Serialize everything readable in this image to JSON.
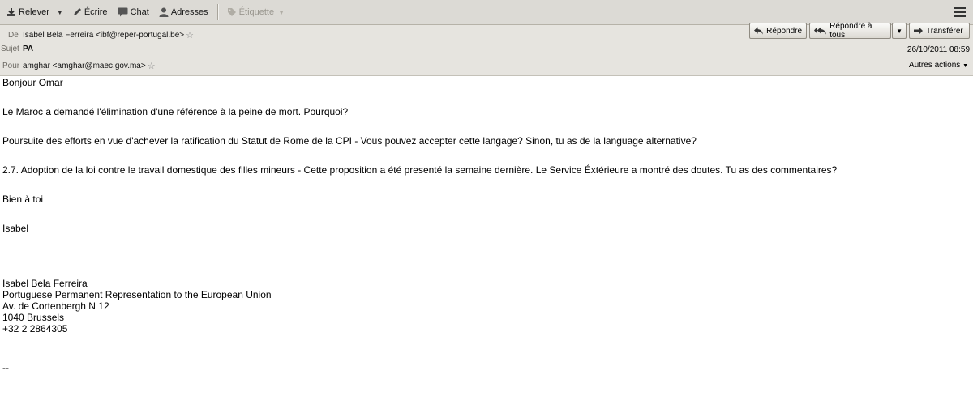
{
  "toolbar": {
    "relever": "Relever",
    "ecrire": "Écrire",
    "chat": "Chat",
    "adresses": "Adresses",
    "etiquette": "Étiquette"
  },
  "header": {
    "from_label": "De",
    "from_value": "Isabel Bela Ferreira <ibf@reper-portugal.be>",
    "subject_label": "Sujet",
    "subject_value": "PA",
    "to_label": "Pour",
    "to_value": "amghar <amghar@maec.gov.ma>",
    "date": "26/10/2011 08:59",
    "reply": "Répondre",
    "reply_all": "Répondre à tous",
    "forward": "Transférer",
    "more_actions": "Autres actions"
  },
  "body": {
    "greeting": "Bonjour Omar",
    "para1": "Le Maroc a demandé l'élimination d'une référence à la peine de mort. Pourquoi?",
    "para2": "Poursuite des efforts en vue d'achever la ratification du Statut de Rome de la CPI - Vous pouvez accepter cette langage? Sinon, tu as de la language alternative?",
    "para3": "2.7. Adoption de la loi contre le travail domestique des filles mineurs - Cette proposition a été presenté la semaine dernière. Le Service Éxtérieure a montré des doutes. Tu as des commentaires?",
    "closing": "Bien à toi",
    "name": "Isabel",
    "sig": [
      "Isabel Bela Ferreira",
      "Portuguese Permanent Representation to the European Union",
      "Av. de Cortenbergh N 12",
      "1040 Brussels",
      "+32 2 2864305"
    ],
    "dash": "--"
  }
}
